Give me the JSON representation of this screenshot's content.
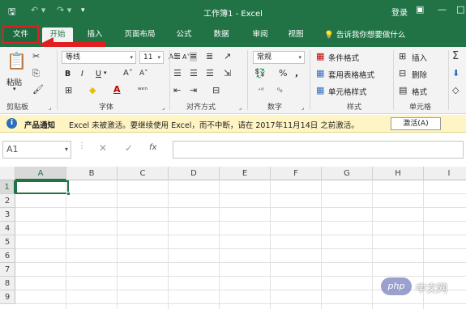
{
  "window": {
    "title": "工作簿1 - Excel",
    "login": "登录",
    "quick_access": {
      "save_icon": "save-icon",
      "undo_icon": "undo-icon",
      "redo_icon": "redo-icon"
    },
    "restore_icon": "restore-window-icon",
    "minimize_icon": "minimize-icon",
    "maximize_icon": "maximize-icon"
  },
  "tabs": {
    "file": "文件",
    "items": [
      "开始",
      "插入",
      "页面布局",
      "公式",
      "数据",
      "审阅",
      "视图"
    ],
    "active": "开始",
    "tell_me": "告诉我你想要做什么",
    "highlight_color": "#e02020"
  },
  "ribbon": {
    "clipboard": {
      "paste": "粘贴",
      "label": "剪贴板"
    },
    "font": {
      "name": "等线",
      "size": "11",
      "bold": "B",
      "italic": "I",
      "underline": "U",
      "label": "字体"
    },
    "alignment": {
      "label": "对齐方式"
    },
    "number": {
      "format": "常规",
      "label": "数字"
    },
    "styles": {
      "cond_format": "条件格式",
      "table_format": "套用表格格式",
      "cell_style": "单元格样式",
      "label": "样式"
    },
    "cells": {
      "insert": "插入",
      "delete": "删除",
      "format": "格式",
      "label": "单元格"
    }
  },
  "notice": {
    "title": "产品通知",
    "message": "Excel 未被激活。要继续使用 Excel，而不中断，请在 2017年11月14日 之前激活。",
    "button": "激活(A)"
  },
  "formula_bar": {
    "name_box": "A1",
    "fx": "fx",
    "value": ""
  },
  "sheet": {
    "columns": [
      "A",
      "B",
      "C",
      "D",
      "E",
      "F",
      "G",
      "H",
      "I"
    ],
    "rows": [
      "1",
      "2",
      "3",
      "4",
      "5",
      "6",
      "7",
      "8",
      "9"
    ],
    "selected": "A1"
  },
  "watermark": {
    "logo": "php",
    "site": "中文网"
  },
  "colors": {
    "accent": "#217346",
    "notice_bg": "#fff4c4"
  }
}
